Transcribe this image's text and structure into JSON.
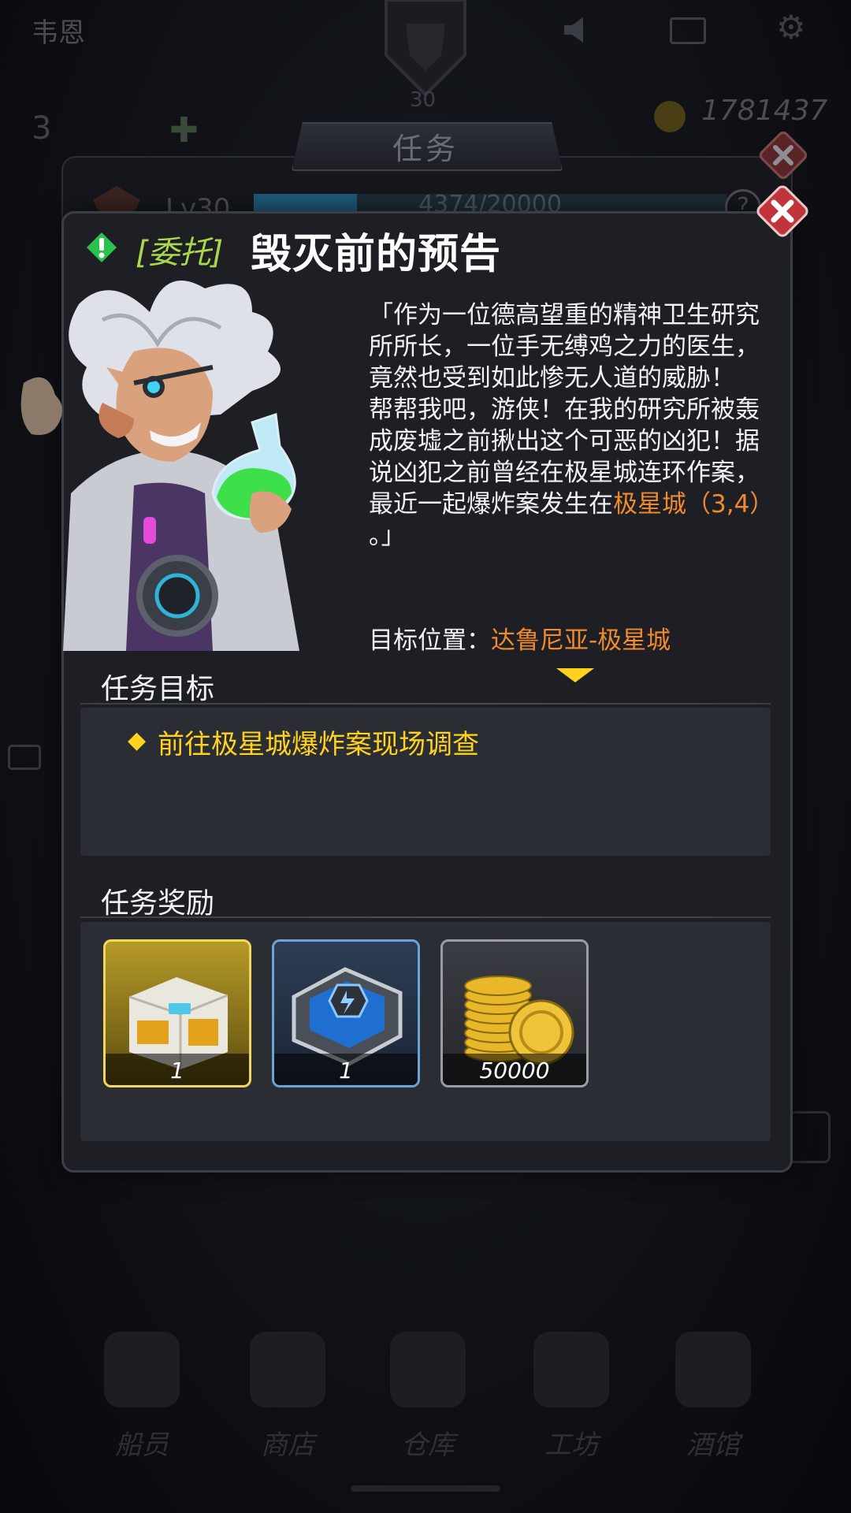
{
  "background": {
    "player_name": "韦恩",
    "player_level": "30",
    "stat_value": "3",
    "gold": "1781437",
    "bottom_nav": [
      {
        "label": "船员",
        "icon": "crew-icon"
      },
      {
        "label": "商店",
        "icon": "shop-icon"
      },
      {
        "label": "仓库",
        "icon": "warehouse-icon"
      },
      {
        "label": "工坊",
        "icon": "workshop-icon"
      },
      {
        "label": "酒馆",
        "icon": "tavern-icon"
      }
    ]
  },
  "quest_panel": {
    "title": "任务",
    "level": "Lv30",
    "exp": "4374/20000",
    "exp_fraction": 0.2187,
    "help": "?"
  },
  "dialog": {
    "tag": "[委托]",
    "title": "毁灭前的预告",
    "description_part1": "「作为一位德高望重的精神卫生研究所所长，一位手无缚鸡之力的医生，竟然也受到如此惨无人道的威胁！\n帮帮我吧，游侠！在我的研究所被轰成废墟之前揪出这个可恶的凶犯！据说凶犯之前曾经在极星城连环作案，最近一起爆炸案发生在",
    "description_highlight": "极星城（3,4）",
    "description_part2": "\n。」",
    "target_label": "目标位置：",
    "target_value": "达鲁尼亚-极星城",
    "objectives_heading": "任务目标",
    "objective_bullet": "◆",
    "objectives": [
      "前往极星城爆炸案现场调查"
    ],
    "rewards_heading": "任务奖励",
    "rewards": [
      {
        "name": "loot-crate",
        "qty": "1"
      },
      {
        "name": "energy-capsule",
        "qty": "1"
      },
      {
        "name": "gold-coins",
        "qty": "50000"
      }
    ]
  },
  "colors": {
    "accent_orange": "#f08a2e",
    "objective_yellow": "#ffd21e",
    "tag_green": "#a9d94a",
    "close_red": "#c0353a"
  }
}
